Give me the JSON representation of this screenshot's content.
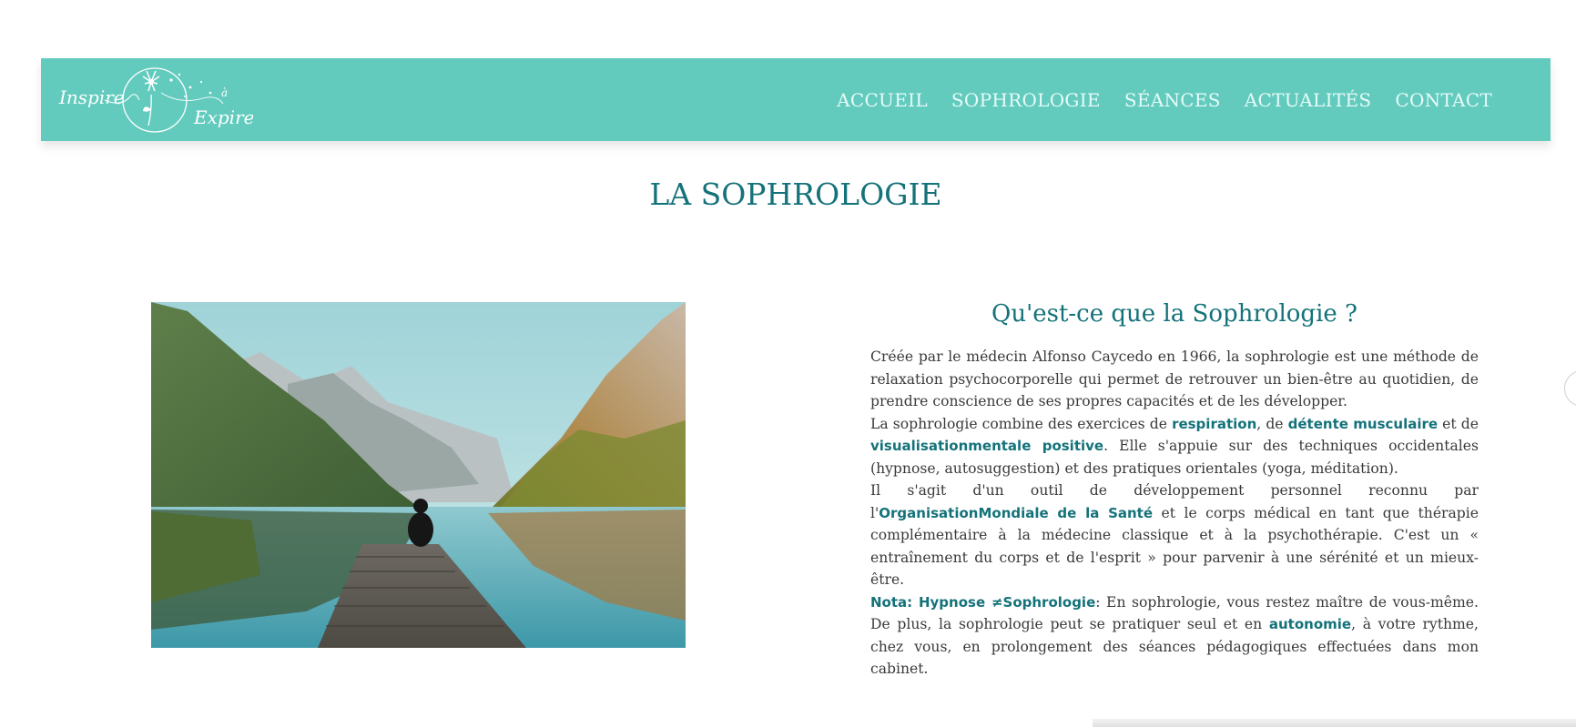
{
  "header": {
    "logo": {
      "text_top": "Inspire",
      "text_middle": "à",
      "text_bottom": "Expire"
    },
    "nav": [
      "ACCUEIL",
      "SOPHROLOGIE",
      "SÉANCES",
      "ACTUALITÉS",
      "CONTACT"
    ]
  },
  "page": {
    "title": "LA SOPHROLOGIE"
  },
  "section": {
    "title": "Qu'est-ce que la Sophrologie ?",
    "p1": "Créée par le médecin Alfonso Caycedo en 1966, la sophrologie est une méthode de relaxation psychocorporelle qui permet de retrouver un bien-être au quotidien, de prendre conscience de ses propres capacités et de les développer.",
    "p2": {
      "t1": "La sophrologie combine des exercices de ",
      "h1": "respiration",
      "t2": ", de ",
      "h2": "détente musculaire",
      "t3": " et de ",
      "h3": "visualisationmentale positive",
      "t4": ". Elle s'appuie sur des techniques occidentales (hypnose, autosuggestion) et des pratiques orientales (yoga, méditation)."
    },
    "p3": {
      "t1": "Il s'agit d'un outil de développement personnel reconnu par l'",
      "h1": "OrganisationMondiale de la Santé",
      "t2": " et le corps médical en tant que thérapie complémentaire à la médecine classique et à la psychothérapie. C'est un « entraînement du corps et de l'esprit » pour parvenir à une sérénité et un mieux-être."
    },
    "p4": {
      "h1": "Nota: Hypnose ≠Sophrologie",
      "t1": ": En sophrologie, vous restez maître de vous-même. De plus, la sophrologie peut se pratiquer seul et en ",
      "h2": "autonomie",
      "t2": ", à votre rythme, chez vous, en prolongement des séances pédagogiques effectuées dans mon cabinet."
    }
  },
  "colors": {
    "header_bg": "#62cbbe",
    "accent": "#14727a",
    "text": "#3a3a3a"
  }
}
